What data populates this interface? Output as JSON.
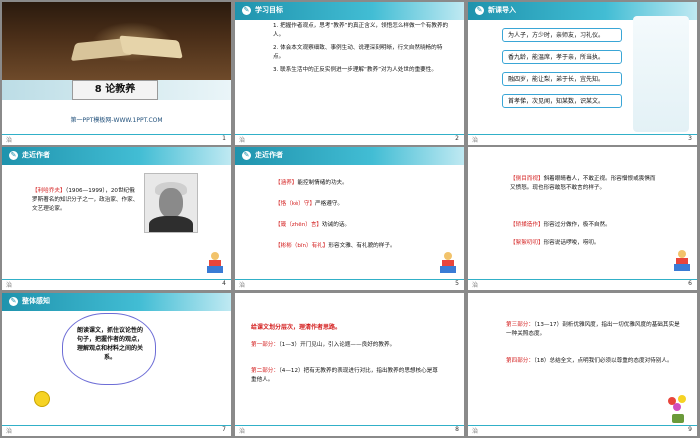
{
  "slide1": {
    "title": "8 论教养",
    "site": "第一PPT模板网-WWW.1PPT.COM",
    "number": "1",
    "footer_icon": "治"
  },
  "slide2": {
    "header": "学习目标",
    "items": [
      "1. 把握作者观点，思考“教养”的真正含义，领悟怎么样做一个有教养的人。",
      "2. 体会本文观察细致、事例生动、说理深刻明晰，行文自然晓畅的特点。",
      "3. 联系生活中的正反实例进一步理解“教养”对为人处世的重要性。"
    ],
    "number": "2",
    "footer_icon": "治"
  },
  "slide3": {
    "header": "新课导入",
    "lines": [
      "为人子，方少时，亲师友，习礼仪。",
      "香九龄，能温席，孝于亲，所当执。",
      "融四岁，能让梨，弟于长，宜先知。",
      "首孝悌，次见闻，知某数，识某文。"
    ],
    "number": "3",
    "footer_icon": "治"
  },
  "slide4": {
    "header": "走近作者",
    "name": "【利哈乔夫】",
    "text": "（1906—1999），20世纪俄罗斯著名的知识分子之一，政治家、作家、文艺理论家。",
    "number": "4",
    "footer_icon": "治"
  },
  "slide5": {
    "header": "走近作者",
    "entries": [
      {
        "term": "【涵养】",
        "def": "能控制情绪的功夫。"
      },
      {
        "term": "【恪（kè）守】",
        "def": "严格遵守。"
      },
      {
        "term": "【箴（zhēn）言】",
        "def": "劝诫的话。"
      },
      {
        "term": "【彬彬（bīn）有礼】",
        "def": "形容文雅、有礼貌的样子。"
      }
    ],
    "number": "5",
    "footer_icon": "治"
  },
  "slide6": {
    "entries": [
      {
        "term": "【侧目而视】",
        "def": "斜着眼睛看人，不敢正视。形容憎恨或畏惧而又愤怒。现也形容敢怒不敢言的样子。"
      },
      {
        "term": "【矫揉造作】",
        "def": "形容过分做作，极不自然。"
      },
      {
        "term": "【絮絮叨叨】",
        "def": "形容说话啰唆，唠叨。"
      }
    ],
    "number": "6",
    "footer_icon": "治"
  },
  "slide7": {
    "header": "整体感知",
    "bubble": "朗读课文，抓住议论性的句子，把握作者的观点，理解观点和材料之间的关系。",
    "number": "7",
    "footer_icon": "治"
  },
  "slide8": {
    "heading": "给课文划分层次，理清作者思路。",
    "parts": [
      {
        "term": "第一部分：",
        "def": "（1—3）开门见山，引入论题——良好的教养。"
      },
      {
        "term": "第二部分：",
        "def": "（4—12）把有无教养的表现进行对比，指出教养的思想核心是尊重他人。"
      }
    ],
    "number": "8",
    "footer_icon": "治"
  },
  "slide9": {
    "parts": [
      {
        "term": "第三部分：",
        "def": "（13—17）剖析优雅风度，指出一切优雅风度的基础其实是一种关照态度。"
      },
      {
        "term": "第四部分：",
        "def": "（18）总结全文，点明我们必须以尊重的态度对待别人。"
      }
    ],
    "number": "9",
    "footer_icon": "治"
  },
  "colors": {
    "accent": "#31b0c8",
    "red": "#d42020",
    "border_blue": "#3aa6d6"
  },
  "icons": [
    "book-image",
    "portrait-image",
    "kid-icon",
    "smiley-icon",
    "flower-icon"
  ]
}
